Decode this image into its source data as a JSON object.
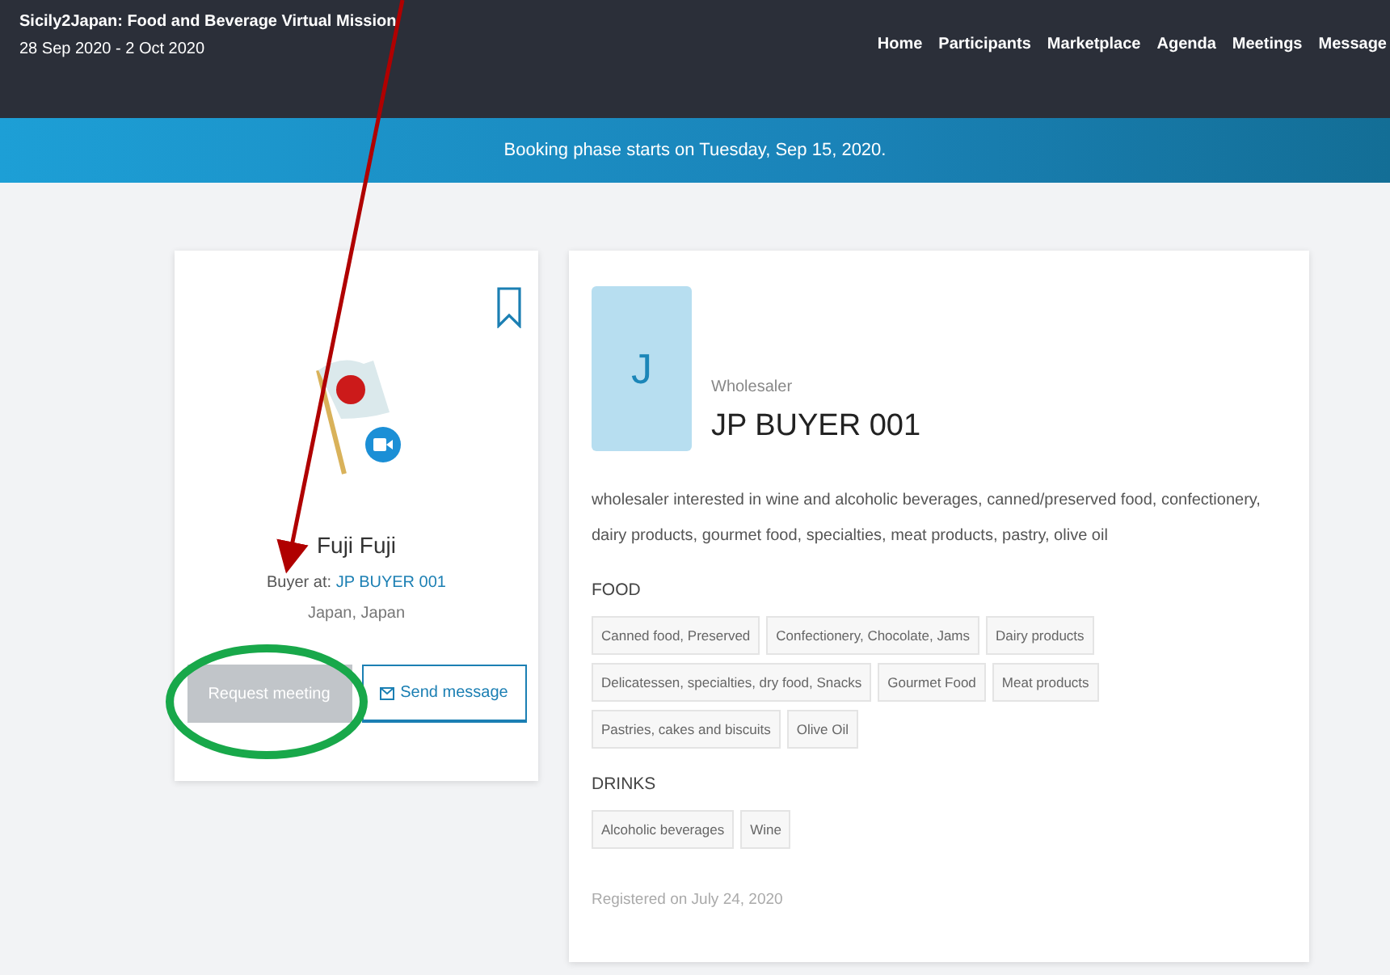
{
  "header": {
    "title": "Sicily2Japan: Food and Beverage Virtual Mission",
    "dates": "28 Sep 2020 - 2 Oct 2020",
    "nav": [
      "Home",
      "Participants",
      "Marketplace",
      "Agenda",
      "Meetings",
      "Message"
    ]
  },
  "banner": "Booking phase starts on Tuesday, Sep 15, 2020.",
  "profile": {
    "name": "Fuji Fuji",
    "role_prefix": "Buyer at:",
    "company": "JP BUYER 001",
    "location": "Japan, Japan",
    "buttons": [
      {
        "label": "Request meeting",
        "kind": "filled",
        "disabled": true
      },
      {
        "label": "Send message",
        "kind": "outline",
        "disabled": false
      }
    ]
  },
  "company": {
    "initial": "J",
    "type": "Wholesaler",
    "name": "JP BUYER 001",
    "description": "wholesaler interested in wine and alcoholic beverages, canned/preserved food, confectionery, dairy products, gourmet food, specialties, meat products, pastry, olive oil",
    "categories": [
      {
        "title": "FOOD",
        "tags": [
          "Canned food, Preserved",
          "Confectionery, Chocolate, Jams",
          "Dairy products",
          "Delicatessen, specialties, dry food, Snacks",
          "Gourmet Food",
          "Meat products",
          "Pastries, cakes and biscuits",
          "Olive Oil"
        ]
      },
      {
        "title": "DRINKS",
        "tags": [
          "Alcoholic beverages",
          "Wine"
        ]
      }
    ],
    "registered": "Registered on July 24, 2020"
  }
}
